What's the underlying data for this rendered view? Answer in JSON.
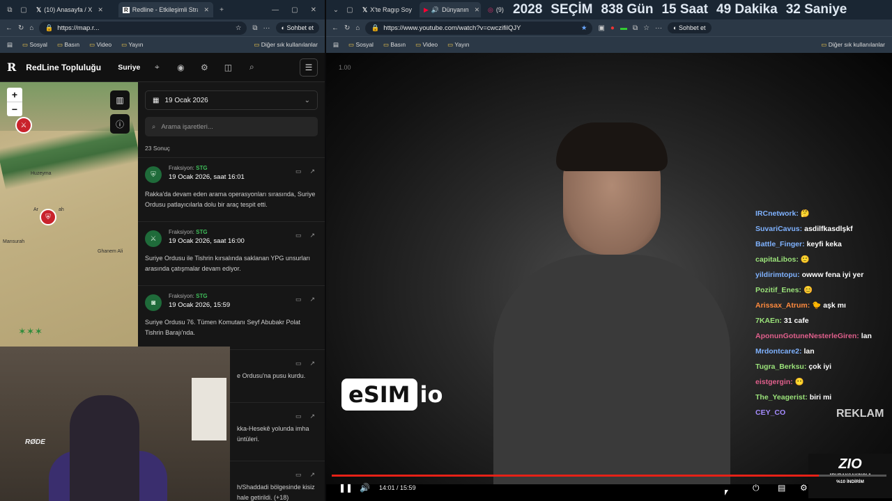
{
  "left_browser": {
    "tabs": [
      {
        "label": "(10) Anasayfa / X",
        "icon": "x-icon"
      },
      {
        "label": "Redline - Etkileşimli Strateji",
        "icon": "redline-icon"
      }
    ],
    "url": "https://map.r...",
    "profile_button": "Sohbet et",
    "bookmarks": [
      "Sosyal",
      "Basın",
      "Video",
      "Yayın"
    ],
    "bookmarks_right": "Diğer sık kullanılanlar"
  },
  "redline": {
    "logo": "R",
    "title": "RedLine Topluluğu",
    "country": "Suriye",
    "date": "19 Ocak 2026",
    "search_placeholder": "Arama işaretleri...",
    "result_count": "23 Sonuç",
    "items": [
      {
        "faction_label": "Fraksiyon:",
        "faction": "STG",
        "timestamp": "19 Ocak 2026, saat 16:01",
        "description": "Rakka'da devam eden arama operasyonları sırasında, Suriye Ordusu patlayıcılarla dolu bir araç tespit etti.",
        "icon": "shield-icon"
      },
      {
        "faction_label": "Fraksiyon:",
        "faction": "STG",
        "timestamp": "19 Ocak 2026, saat 16:00",
        "description": "Suriye Ordusu ile Tishrin kırsalında saklanan YPG unsurları arasında çatışmalar devam ediyor.",
        "icon": "rifle-icon"
      },
      {
        "faction_label": "Fraksiyon:",
        "faction": "STG",
        "timestamp": "19 Ocak 2026, 15:59",
        "description": "Suriye Ordusu 76. Tümen Komutanı Seyf Abubakr Polat Tishrin Barajı'nda.",
        "icon": "camera-icon"
      },
      {
        "faction_label": "",
        "faction": "",
        "timestamp": "",
        "description": "e Ordusu'na pusu kurdu.",
        "icon": ""
      },
      {
        "faction_label": "",
        "faction": "",
        "timestamp": "",
        "description": "kka-Hesekê yolunda imha üntüleri.",
        "icon": ""
      },
      {
        "faction_label": "",
        "faction": "",
        "timestamp": "",
        "description": "h/Shaddadi bölgesinde kisiz hale getirildi. (+18)",
        "icon": ""
      }
    ],
    "map_labels": [
      "Huzeyma",
      "Ar",
      "ah",
      "Mansurah",
      "Ghanem Ali"
    ]
  },
  "webcam": {
    "mic_brand": "RØDE"
  },
  "right_browser": {
    "tabs": [
      {
        "label": "X'te Ragıp Soy",
        "icon": "x-icon"
      },
      {
        "label": "Dünyanın",
        "icon": "youtube-icon"
      },
      {
        "label": "(9)",
        "icon": "instagram-icon"
      }
    ],
    "url": "https://www.youtube.com/watch?v=cwczifilQJY",
    "profile_button": "Sohbet et",
    "bookmarks": [
      "Sosyal",
      "Basın",
      "Video",
      "Yayın"
    ],
    "bookmarks_right": "Diğer sık kullanılanlar"
  },
  "banner": {
    "year": "2028",
    "label": "SEÇİM",
    "days": "838 Gün",
    "hours": "15 Saat",
    "minutes": "49 Dakika",
    "seconds": "32 Saniye"
  },
  "youtube": {
    "version": "1.00",
    "ad_logo": "eSIM",
    "ad_logo_suffix": "io",
    "reklam": "REKLAM",
    "current_time": "14:01",
    "duration": "15:59",
    "progress": 0.878,
    "zio_logo": "ZIO",
    "zio_line1": "\"BURAKSAKINOL\"",
    "zio_line2": "%10 İNDİRİM"
  },
  "chat": [
    {
      "user": "IRCnetwork:",
      "msg": "🤔",
      "color": "#7fb2ff"
    },
    {
      "user": "SuvariCavus:",
      "msg": "asdilfkasdlşkf",
      "color": "#7fb2ff"
    },
    {
      "user": "Battle_Finger:",
      "msg": "keyfi keka",
      "color": "#7fb2ff"
    },
    {
      "user": "capitaLibos:",
      "msg": "🙂",
      "color": "#9be37a"
    },
    {
      "user": "yildirimtopu:",
      "msg": "owww fena iyi yer",
      "color": "#7fb2ff"
    },
    {
      "user": "Pozitif_Enes:",
      "msg": "😊",
      "color": "#9be37a"
    },
    {
      "user": "Arissax_Atrum:",
      "msg": "🐤 aşk mı",
      "color": "#ff8a3d"
    },
    {
      "user": "7KAEn:",
      "msg": "31 cafe",
      "color": "#9be37a"
    },
    {
      "user": "AponunGotuneNesterleGiren:",
      "msg": "lan",
      "color": "#e05f8c"
    },
    {
      "user": "Mrdontcare2:",
      "msg": "lan",
      "color": "#7fb2ff"
    },
    {
      "user": "Tugra_Berksu:",
      "msg": "çok iyi",
      "color": "#9be37a"
    },
    {
      "user": "eistgergin:",
      "msg": "😶",
      "color": "#e05f8c"
    },
    {
      "user": "The_Yeagerist:",
      "msg": "biri mi",
      "color": "#9be37a"
    },
    {
      "user": "CEY_CO",
      "msg": "",
      "color": "#a58cff"
    }
  ]
}
